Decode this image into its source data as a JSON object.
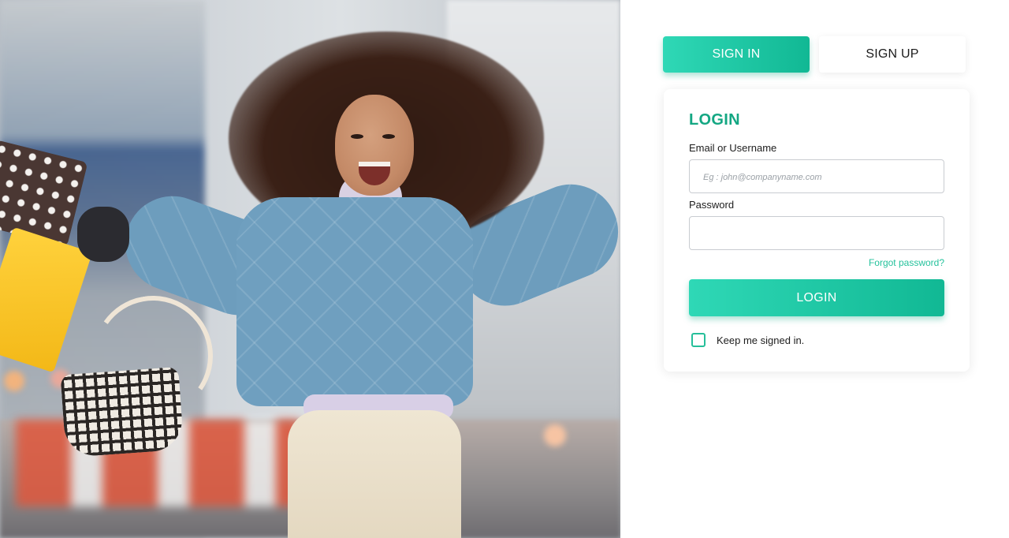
{
  "tabs": {
    "signin_label": "SIGN IN",
    "signup_label": "SIGN UP",
    "active": "signin"
  },
  "login": {
    "title": "LOGIN",
    "email_label": "Email or Username",
    "email_placeholder": "Eg : john@companyname.com",
    "email_value": "",
    "password_label": "Password",
    "password_value": "",
    "forgot_label": "Forgot password?",
    "submit_label": "LOGIN",
    "remember_label": "Keep me signed in.",
    "remember_checked": false
  },
  "colors": {
    "accent": "#14a783",
    "accent_gradient_start": "#2fd8b6",
    "accent_gradient_end": "#11b894",
    "link": "#25c29c"
  }
}
